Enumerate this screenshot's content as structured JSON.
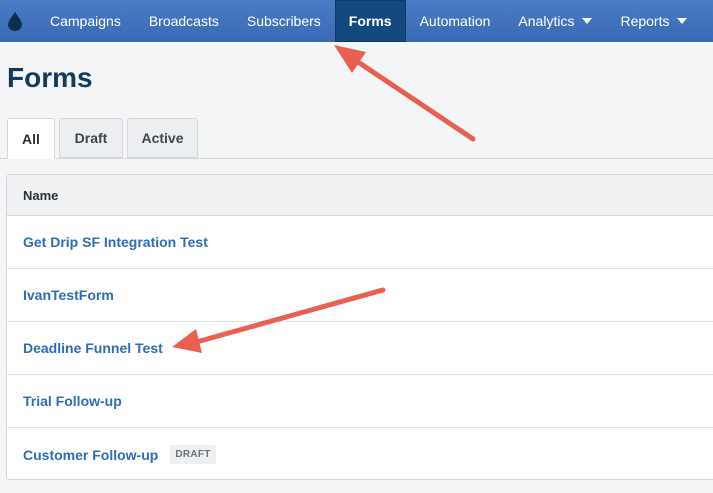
{
  "nav": {
    "items": [
      {
        "label": "Campaigns",
        "active": false,
        "dropdown": false
      },
      {
        "label": "Broadcasts",
        "active": false,
        "dropdown": false
      },
      {
        "label": "Subscribers",
        "active": false,
        "dropdown": false
      },
      {
        "label": "Forms",
        "active": true,
        "dropdown": false
      },
      {
        "label": "Automation",
        "active": false,
        "dropdown": false
      },
      {
        "label": "Analytics",
        "active": false,
        "dropdown": true
      },
      {
        "label": "Reports",
        "active": false,
        "dropdown": true
      }
    ]
  },
  "page": {
    "title": "Forms"
  },
  "tabs": [
    {
      "label": "All",
      "active": true
    },
    {
      "label": "Draft",
      "active": false
    },
    {
      "label": "Active",
      "active": false
    }
  ],
  "table": {
    "header": "Name",
    "rows": [
      {
        "name": "Get Drip SF Integration Test",
        "badge": ""
      },
      {
        "name": "IvanTestForm",
        "badge": ""
      },
      {
        "name": "Deadline Funnel Test",
        "badge": ""
      },
      {
        "name": "Trial Follow-up",
        "badge": ""
      },
      {
        "name": "Customer Follow-up",
        "badge": "DRAFT"
      }
    ]
  },
  "colors": {
    "nav_bg": "#3a6ab4",
    "nav_active": "#13497f",
    "link": "#2d6db5",
    "annotation_arrow": "#e8604f"
  },
  "icons": {
    "logo": "drop-logo-icon",
    "dropdown": "caret-down-icon"
  }
}
